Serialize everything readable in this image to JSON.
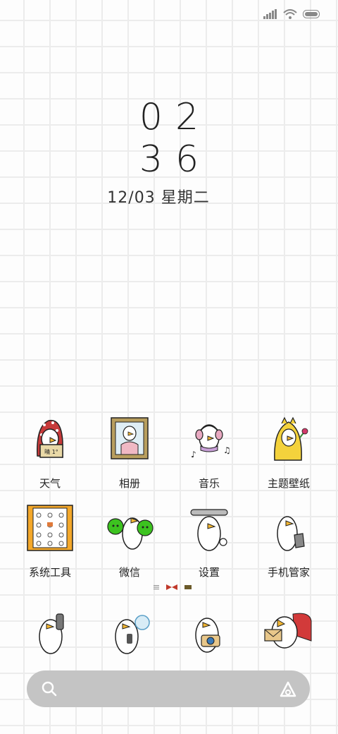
{
  "clock": {
    "hours": "02",
    "minutes": "36"
  },
  "date": {
    "text": "12/03 星期二"
  },
  "apps_row1": [
    {
      "label": "天气",
      "icon": "weather-duck-icon"
    },
    {
      "label": "相册",
      "icon": "gallery-duck-icon"
    },
    {
      "label": "音乐",
      "icon": "music-duck-icon"
    },
    {
      "label": "主题壁纸",
      "icon": "themes-duck-icon"
    }
  ],
  "apps_row2": [
    {
      "label": "系统工具",
      "icon": "system-tools-folder-icon"
    },
    {
      "label": "微信",
      "icon": "wechat-duck-icon"
    },
    {
      "label": "设置",
      "icon": "settings-duck-icon"
    },
    {
      "label": "手机管家",
      "icon": "security-duck-icon"
    }
  ],
  "weather_sign": "晴 1°",
  "dock": [
    "phone-duck-icon",
    "messages-duck-icon",
    "camera-duck-icon",
    "browser-duck-icon"
  ],
  "colors": {
    "grid": "#ececec",
    "search_bar": "#c4c4c4",
    "wechat_green": "#3cc31f",
    "accent_red": "#d23a3a",
    "yellow": "#f4d23c"
  }
}
